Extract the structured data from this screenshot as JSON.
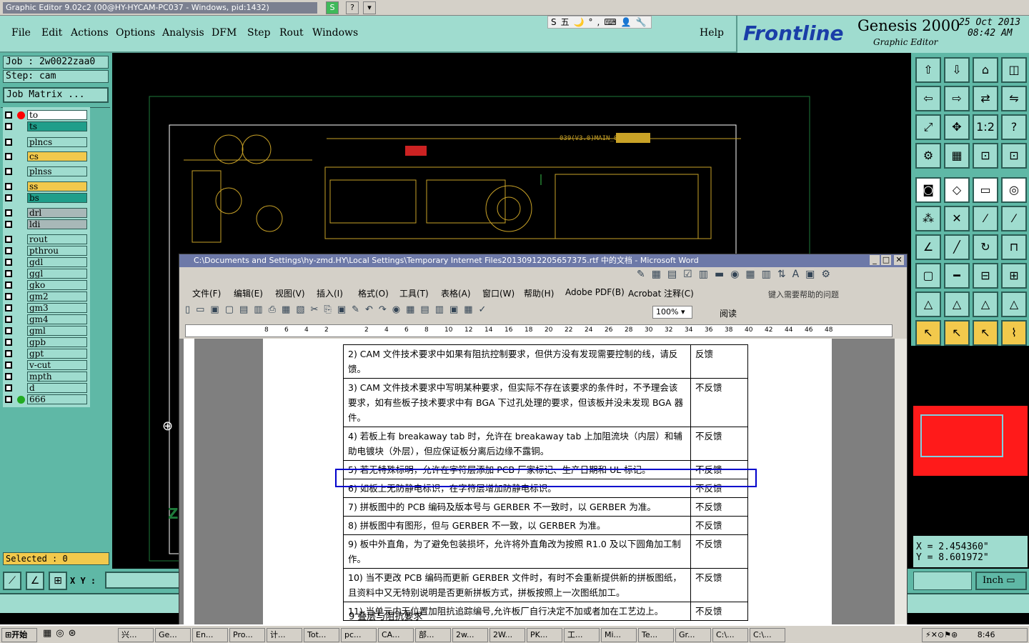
{
  "window_title": "Graphic Editor 9.02c2 (00@HY-HYCAM-PC037 - Windows, pid:1432)",
  "menu": [
    "File",
    "Edit",
    "Actions",
    "Options",
    "Analysis",
    "DFM",
    "Step",
    "Rout",
    "Windows"
  ],
  "help": "Help",
  "brand": {
    "logo": "Frontline",
    "product": "Genesis 2000",
    "subtitle": "Graphic Editor",
    "date": "25 Oct 2013",
    "time": "08:42 AM"
  },
  "job": "Job : 2w0022zaa0",
  "step": "Step: cam",
  "job_matrix": "Job Matrix ...",
  "layers": [
    {
      "name": "to",
      "color": "#ffffff",
      "dot": "#ff0000"
    },
    {
      "name": "ts",
      "color": "#1f9e8a"
    },
    {
      "name": "plncs",
      "color": "#9fdccf"
    },
    {
      "name": "cs",
      "color": "#f2c94c"
    },
    {
      "name": "plnss",
      "color": "#9fdccf"
    },
    {
      "name": "ss",
      "color": "#f2c94c"
    },
    {
      "name": "bs",
      "color": "#1f9e8a"
    },
    {
      "name": "drl",
      "color": "#a8b8b8"
    },
    {
      "name": "ldi",
      "color": "#a8b8b8"
    },
    {
      "name": "rout",
      "color": "#9fdccf"
    },
    {
      "name": "pthrou",
      "color": "#9fdccf"
    },
    {
      "name": "gdl",
      "color": "#9fdccf"
    },
    {
      "name": "ggl",
      "color": "#9fdccf"
    },
    {
      "name": "gko",
      "color": "#9fdccf"
    },
    {
      "name": "gm2",
      "color": "#9fdccf"
    },
    {
      "name": "gm3",
      "color": "#9fdccf"
    },
    {
      "name": "gm4",
      "color": "#9fdccf"
    },
    {
      "name": "gml",
      "color": "#9fdccf"
    },
    {
      "name": "gpb",
      "color": "#9fdccf"
    },
    {
      "name": "gpt",
      "color": "#9fdccf"
    },
    {
      "name": "v-cut",
      "color": "#9fdccf"
    },
    {
      "name": "mpth",
      "color": "#9fdccf"
    },
    {
      "name": "d",
      "color": "#9fdccf"
    },
    {
      "name": "666",
      "color": "#9fdccf",
      "dot": "#22aa22"
    }
  ],
  "selected": "Selected : 0",
  "xy_label": "X Y :",
  "coords": {
    "x": "X = 2.454360\"",
    "y": "Y = 8.601972\""
  },
  "units": "Inch",
  "word": {
    "title": "C:\\Documents and Settings\\hy-zmd.HY\\Local Settings\\Temporary Internet Files20130912205657375.rtf 中的文档 - Microsoft Word",
    "menu": [
      "文件(F)",
      "编辑(E)",
      "视图(V)",
      "插入(I)",
      "格式(O)",
      "工具(T)",
      "表格(A)",
      "窗口(W)",
      "帮助(H)",
      "Adobe PDF(B)",
      "Acrobat 注释(C)"
    ],
    "help_box": "键入需要帮助的问题",
    "zoom": "100%",
    "read": "阅读",
    "ruler": [
      "8",
      "6",
      "4",
      "2",
      "",
      "2",
      "4",
      "6",
      "8",
      "10",
      "12",
      "14",
      "16",
      "18",
      "20",
      "22",
      "24",
      "26",
      "28",
      "30",
      "32",
      "34",
      "36",
      "38",
      "40",
      "42",
      "44",
      "46",
      "48"
    ],
    "rows": [
      {
        "text": "2) CAM 文件技术要求中如果有阻抗控制要求，但供方没有发现需要控制的线，请反馈。",
        "resp": "反馈"
      },
      {
        "text": "3) CAM 文件技术要求中写明某种要求，但实际不存在该要求的条件时，不予理会该要求，如有些板子技术要求中有 BGA 下过孔处理的要求，但该板并没未发现 BGA 器件。",
        "resp": "不反馈"
      },
      {
        "text": "4) 若板上有 breakaway tab 时，允许在 breakaway tab 上加阻流块（内层）和辅助电镀块（外层），但应保证板分离后边缘不露铜。",
        "resp": "不反馈"
      },
      {
        "text": "5) 若无特殊标明，允许在字符层添加 PCB 厂家标记、生产日期和 UL 标记。",
        "resp": "不反馈"
      },
      {
        "text": "6) 如板上无防静电标识，在字符层增加防静电标识。",
        "resp": "不反馈"
      },
      {
        "text": "7) 拼板图中的 PCB 编码及版本号与 GERBER 不一致时，以 GERBER 为准。",
        "resp": "不反馈"
      },
      {
        "text": "8) 拼板图中有图形，但与 GERBER 不一致，以 GERBER 为准。",
        "resp": "不反馈"
      },
      {
        "text": "9) 板中外直角，为了避免包装损坏，允许将外直角改为按照 R1.0 及以下圆角加工制作。",
        "resp": "不反馈"
      },
      {
        "text": "10) 当不更改 PCB 编码而更新 GERBER 文件时，有时不会重新提供新的拼板图纸，且资料中又无特别说明是否更新拼板方式，拼板按照上一次图纸加工。",
        "resp": "不反馈"
      },
      {
        "text": "11) 当单元内无位置加阻抗追踪编号,允许板厂自行决定不加或者加在工艺边上。",
        "resp": "不反馈"
      }
    ],
    "section": "9 叠层与阻抗要求"
  },
  "taskbar": {
    "start": "开始",
    "tasks": [
      "兴...",
      "Ge...",
      "En...",
      "Pro...",
      "计...",
      "Tot...",
      "pc...",
      "CA...",
      "部...",
      "2w...",
      "2W...",
      "PK...",
      "工...",
      "Mi...",
      "Te...",
      "Gr...",
      "C:\\...",
      "C:\\..."
    ],
    "clock": "8:46"
  },
  "colors": {
    "panel": "#5fb8a6",
    "light": "#9fdccf",
    "highlight": "#0000cc"
  }
}
